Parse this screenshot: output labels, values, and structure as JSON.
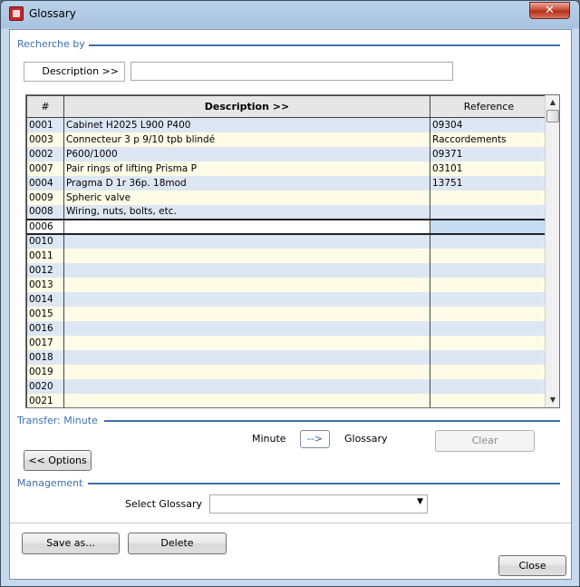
{
  "window": {
    "title": "Glossary",
    "close_glyph": "✕"
  },
  "search": {
    "section_title": "Recherche by",
    "field_label": "Description >>",
    "value": ""
  },
  "grid": {
    "headers": [
      "#",
      "Description >>",
      "Reference"
    ],
    "rows": [
      {
        "num": "0001",
        "desc": "Cabinet H2025 L900  P400",
        "ref": "09304"
      },
      {
        "num": "0003",
        "desc": "Connecteur 3 p 9/10 tpb blindé",
        "ref": "Raccordements"
      },
      {
        "num": "0002",
        "desc": "P600/1000",
        "ref": "09371"
      },
      {
        "num": "0007",
        "desc": "Pair rings of lifting Prisma P",
        "ref": "03101"
      },
      {
        "num": "0004",
        "desc": "Pragma D 1r 36p. 18mod",
        "ref": "13751"
      },
      {
        "num": "0009",
        "desc": "Spheric valve",
        "ref": ""
      },
      {
        "num": "0008",
        "desc": "Wiring, nuts, bolts, etc.",
        "ref": ""
      },
      {
        "num": "0006",
        "desc": "",
        "ref": ""
      },
      {
        "num": "0010",
        "desc": "",
        "ref": ""
      },
      {
        "num": "0011",
        "desc": "",
        "ref": ""
      },
      {
        "num": "0012",
        "desc": "",
        "ref": ""
      },
      {
        "num": "0013",
        "desc": "",
        "ref": ""
      },
      {
        "num": "0014",
        "desc": "",
        "ref": ""
      },
      {
        "num": "0015",
        "desc": "",
        "ref": ""
      },
      {
        "num": "0016",
        "desc": "",
        "ref": ""
      },
      {
        "num": "0017",
        "desc": "",
        "ref": ""
      },
      {
        "num": "0018",
        "desc": "",
        "ref": ""
      },
      {
        "num": "0019",
        "desc": "",
        "ref": ""
      },
      {
        "num": "0020",
        "desc": "",
        "ref": ""
      },
      {
        "num": "0021",
        "desc": "",
        "ref": ""
      }
    ],
    "selected_index": 7
  },
  "transfer": {
    "section_title": "Transfer: Minute",
    "minute_label": "Minute",
    "arrow_label": "-->",
    "glossary_label": "Glossary",
    "clear_label": "Clear"
  },
  "options_label": "<< Options",
  "management": {
    "section_title": "Management",
    "select_label": "Select Glossary",
    "select_value": ""
  },
  "buttons": {
    "save_as": "Save as...",
    "delete": "Delete",
    "close": "Close"
  },
  "scroll": {
    "up": "▲",
    "down": "▼"
  },
  "dropdown_glyph": "▼"
}
